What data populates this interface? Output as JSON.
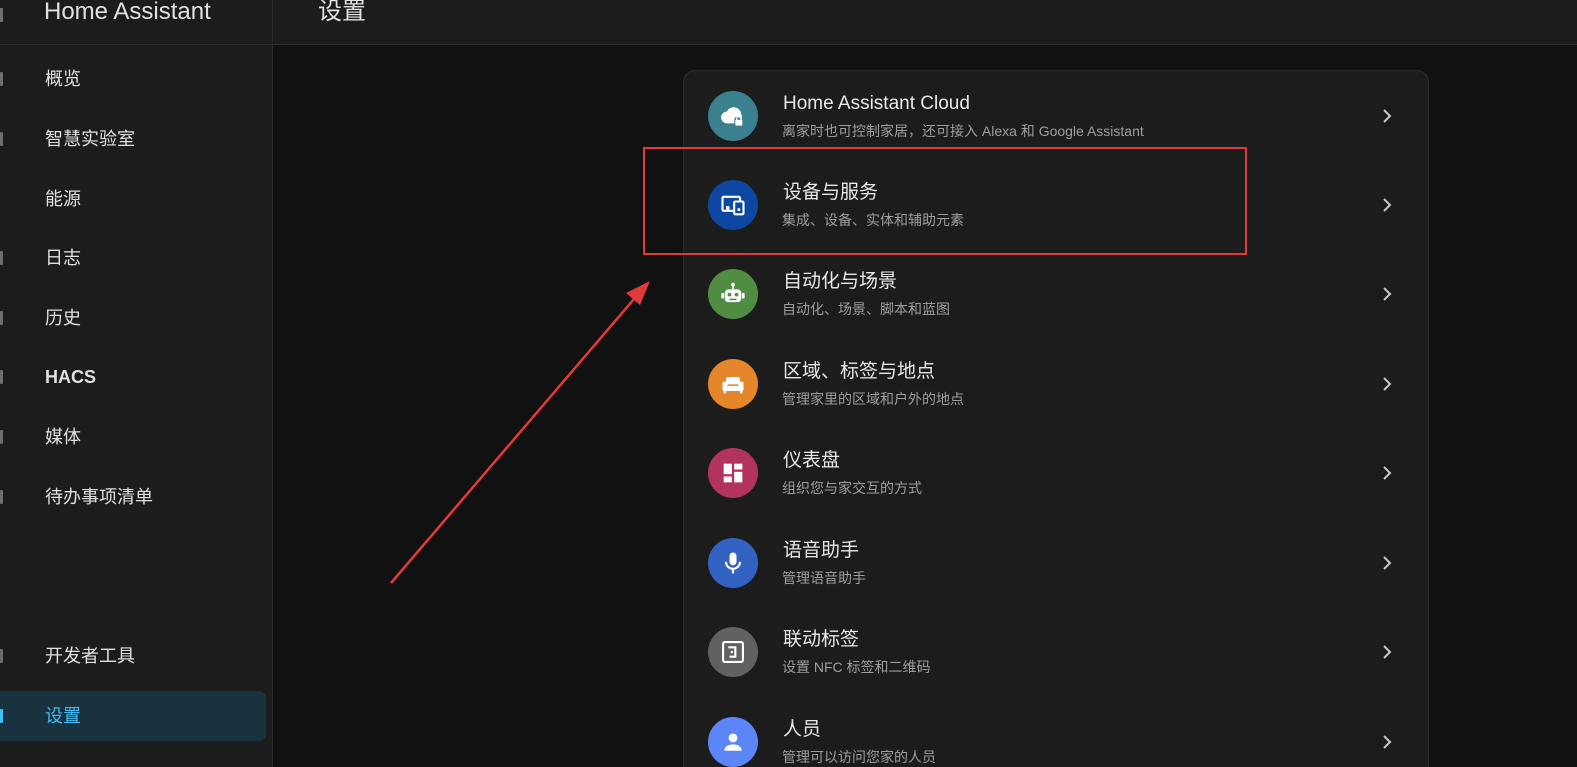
{
  "app": {
    "title": "Home Assistant"
  },
  "topbar": {
    "title": "设置"
  },
  "sidebar": {
    "items": [
      {
        "label": "概览"
      },
      {
        "label": "智慧实验室"
      },
      {
        "label": "能源"
      },
      {
        "label": "日志"
      },
      {
        "label": "历史"
      },
      {
        "label": "HACS"
      },
      {
        "label": "媒体"
      },
      {
        "label": "待办事项清单"
      },
      {
        "label": "开发者工具"
      },
      {
        "label": "设置"
      }
    ]
  },
  "settings": {
    "rows": [
      {
        "title": "Home Assistant Cloud",
        "subtitle": "离家时也可控制家居，还可接入 Alexa 和 Google Assistant",
        "icon": "cloud-lock-icon",
        "color": "#3b808e"
      },
      {
        "title": "设备与服务",
        "subtitle": "集成、设备、实体和辅助元素",
        "icon": "devices-icon",
        "color": "#0d47a1"
      },
      {
        "title": "自动化与场景",
        "subtitle": "自动化、场景、脚本和蓝图",
        "icon": "robot-icon",
        "color": "#518c43"
      },
      {
        "title": "区域、标签与地点",
        "subtitle": "管理家里的区域和户外的地点",
        "icon": "sofa-icon",
        "color": "#e48629"
      },
      {
        "title": "仪表盘",
        "subtitle": "组织您与家交互的方式",
        "icon": "dashboard-icon",
        "color": "#b1345c"
      },
      {
        "title": "语音助手",
        "subtitle": "管理语音助手",
        "icon": "microphone-icon",
        "color": "#3263c3"
      },
      {
        "title": "联动标签",
        "subtitle": "设置 NFC 标签和二维码",
        "icon": "nfc-icon",
        "color": "#616161"
      },
      {
        "title": "人员",
        "subtitle": "管理可以访问您家的人员",
        "icon": "account-icon",
        "color": "#5c85f7"
      }
    ]
  },
  "colors": {
    "accent": "#41bdf5",
    "annotation": "#e4393c"
  }
}
